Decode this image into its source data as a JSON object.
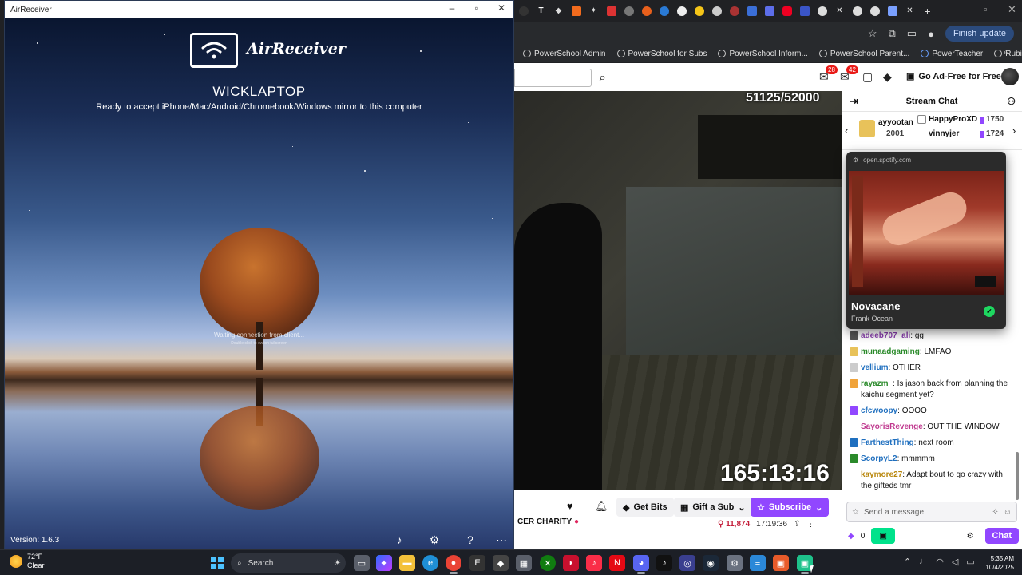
{
  "airreceiver": {
    "window_title": "AirReceiver",
    "app_name": "AirReceiver",
    "host_name": "WICKLAPTOP",
    "ready_text": "Ready to accept iPhone/Mac/Android/Chromebook/Windows mirror to this computer",
    "waiting_text": "Waiting connection from client...",
    "waiting_subtext": "Double click to switch fullscreen",
    "version": "Version: 1.6.3"
  },
  "browser": {
    "finish_update": "Finish update",
    "bookmarks": [
      "PowerSchool Admin",
      "PowerSchool for Subs",
      "PowerSchool Inform...",
      "PowerSchool Parent...",
      "PowerTeacher",
      "Rubicon Atlas"
    ]
  },
  "twitch": {
    "notif_count_1": "28",
    "notif_count_2": "42",
    "ad_free": "Go Ad-Free for Free",
    "video_counter": "51125/52000",
    "video_timer": "165:13:16",
    "get_bits": "Get Bits",
    "gift_sub": "Gift a Sub",
    "subscribe": "Subscribe",
    "stream_title_fragment": "CER CHARITY",
    "viewers": "11,874",
    "uptime": "17:19:36",
    "chat_header": "Stream Chat",
    "leaderboard": {
      "top_name": "ayyootan",
      "top_value": "2001",
      "second_name": "HappyProXD",
      "second_value": "1750",
      "third_name": "vinnyjer",
      "third_value": "1724"
    },
    "chat_input_placeholder": "Send a message",
    "points": "0",
    "chat_button": "Chat"
  },
  "spotify": {
    "url": "open.spotify.com",
    "track": "Novacane",
    "artist": "Frank Ocean"
  },
  "chat_messages": [
    {
      "user": "adeeb707_ali",
      "text": "gg",
      "color": "#8b3fb0"
    },
    {
      "user": "munaadgaming",
      "text": "LMFAO",
      "color": "#2a8a2a"
    },
    {
      "user": "vellium",
      "text": "OTHER",
      "color": "#1f6fbf"
    },
    {
      "user": "rayazm_",
      "text": "Is jason back from planning the kaichu segment yet?",
      "color": "#2a8a2a"
    },
    {
      "user": "cfcwoopy",
      "text": "OOOO",
      "color": "#1f6fbf"
    },
    {
      "user": "SayorisRevenge",
      "text": "OUT THE WINDOW",
      "color": "#c0398f"
    },
    {
      "user": "FarthestThing",
      "text": "next room",
      "color": "#1f6fbf"
    },
    {
      "user": "ScorpyL2",
      "text": "mmmmm",
      "color": "#1f6fbf"
    },
    {
      "user": "kaymore27",
      "text": "Adapt bout to go crazy with the gifteds tmr",
      "color": "#b8860b"
    }
  ],
  "taskbar": {
    "temperature": "72°F",
    "condition": "Clear",
    "search": "Search",
    "time": "5:35 AM",
    "date": "10/4/2025"
  }
}
